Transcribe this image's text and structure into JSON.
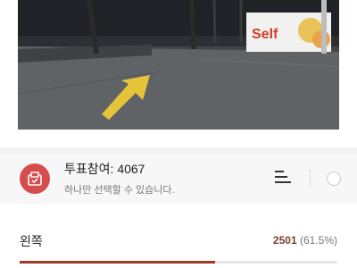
{
  "photo": {
    "sign_text": "Self"
  },
  "poll": {
    "title": "투표참여: ",
    "count": "4067",
    "subtitle": "하나만 선택할 수 있습니다.",
    "icon": "ballot-box-icon",
    "sort_icon": "sort-icon",
    "accent_color": "#d64d4d"
  },
  "options": [
    {
      "label": "왼쪽",
      "votes": "2501",
      "percent_text": "(61.5%)",
      "fraction": 0.615,
      "bar_color": "#a23a2c"
    }
  ]
}
